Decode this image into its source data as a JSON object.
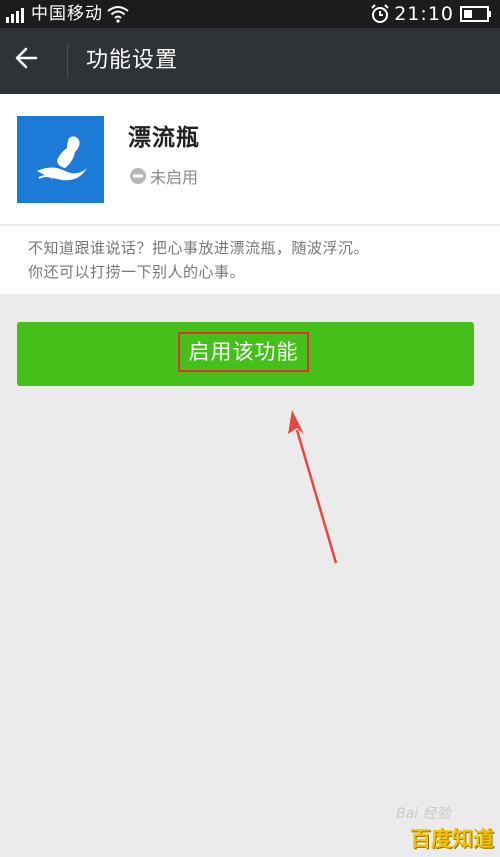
{
  "status_bar": {
    "carrier": "中国移动",
    "time": "21:10"
  },
  "title_bar": {
    "title": "功能设置"
  },
  "feature": {
    "name": "漂流瓶",
    "status": "未启用",
    "icon": "drift-bottle-icon",
    "icon_bg": "#1d7bd8"
  },
  "description": {
    "line1": "不知道跟谁说话？把心事放进漂流瓶，随波浮沉。",
    "line2": "你还可以打捞一下别人的心事。"
  },
  "action": {
    "enable_label": "启用该功能",
    "color": "#45c01a",
    "highlight_color": "#e0312a"
  },
  "watermark": {
    "small": "Bai 经验",
    "big": "百度知道"
  }
}
